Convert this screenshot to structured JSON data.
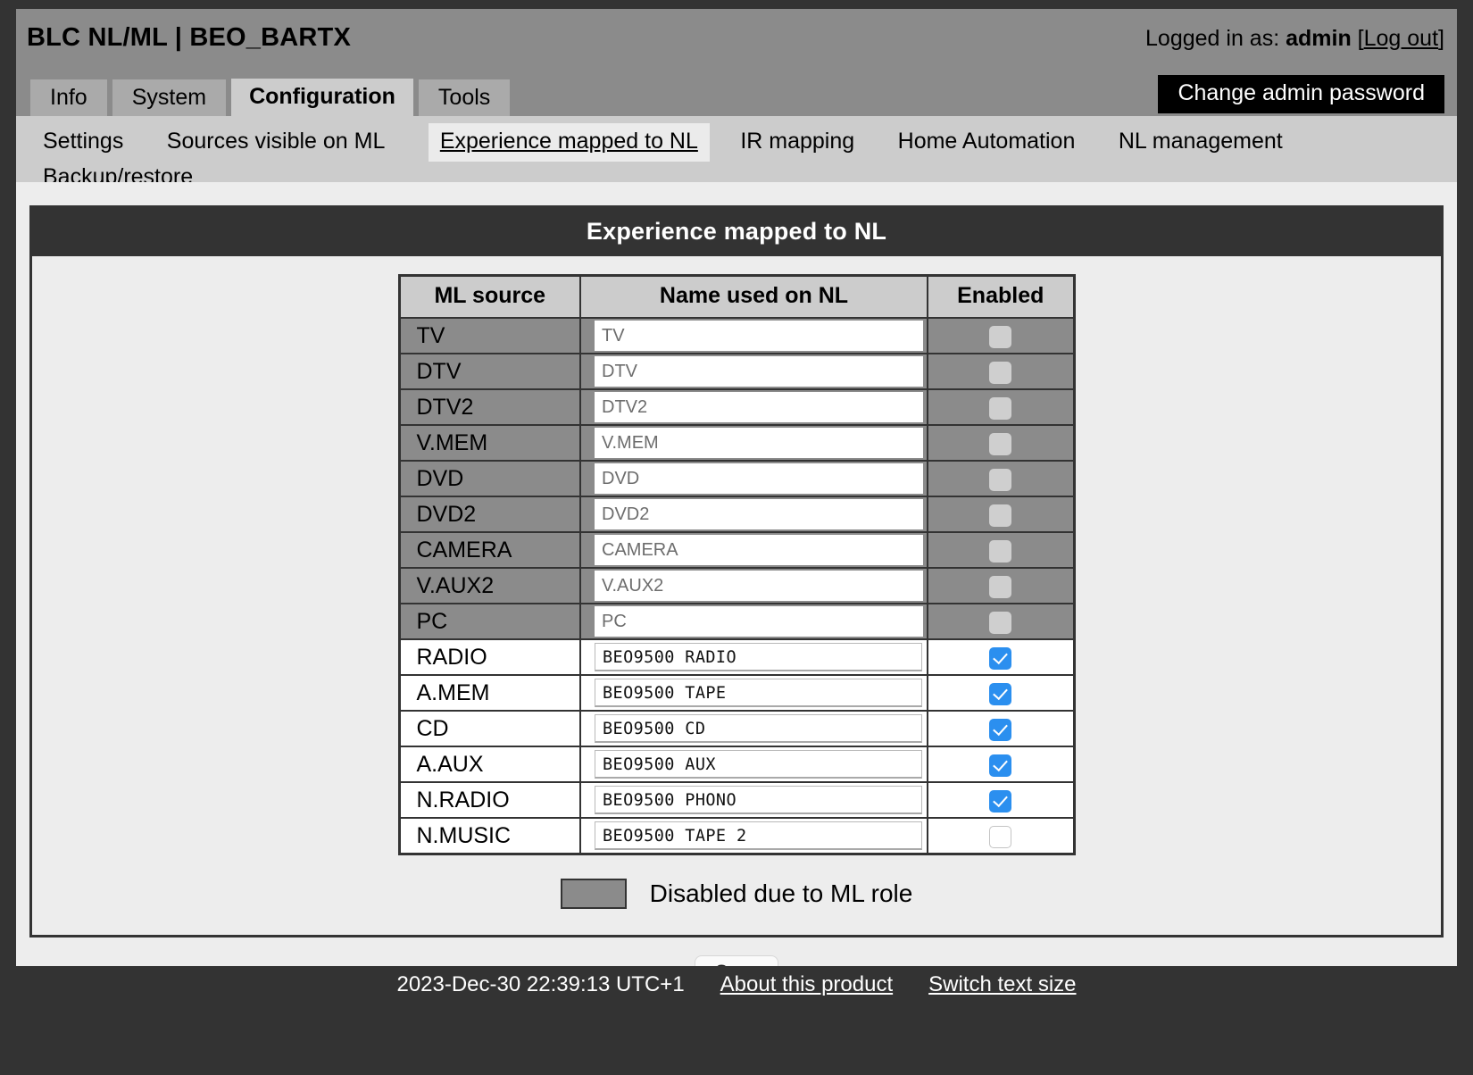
{
  "header": {
    "app_title": "BLC NL/ML | BEO_BARTX",
    "logged_in_prefix": "Logged in as:",
    "username": "admin",
    "logout_open": "[",
    "logout_label": "Log out",
    "logout_close": "]",
    "change_password_label": "Change admin password"
  },
  "tabs": [
    {
      "label": "Info",
      "active": false
    },
    {
      "label": "System",
      "active": false
    },
    {
      "label": "Configuration",
      "active": true
    },
    {
      "label": "Tools",
      "active": false
    }
  ],
  "subnav": [
    {
      "label": "Settings",
      "current": false
    },
    {
      "label": "Sources visible on ML",
      "current": false
    },
    {
      "label": "Experience mapped to NL",
      "current": true
    },
    {
      "label": "IR mapping",
      "current": false
    },
    {
      "label": "Home Automation",
      "current": false
    },
    {
      "label": "NL management",
      "current": false
    },
    {
      "label": "Backup/restore",
      "current": false
    }
  ],
  "panel": {
    "title": "Experience mapped to NL",
    "columns": [
      "ML source",
      "Name used on NL",
      "Enabled"
    ],
    "rows": [
      {
        "source": "TV",
        "name": "TV",
        "enabled": false,
        "disabled_role": true
      },
      {
        "source": "DTV",
        "name": "DTV",
        "enabled": false,
        "disabled_role": true
      },
      {
        "source": "DTV2",
        "name": "DTV2",
        "enabled": false,
        "disabled_role": true
      },
      {
        "source": "V.MEM",
        "name": "V.MEM",
        "enabled": false,
        "disabled_role": true
      },
      {
        "source": "DVD",
        "name": "DVD",
        "enabled": false,
        "disabled_role": true
      },
      {
        "source": "DVD2",
        "name": "DVD2",
        "enabled": false,
        "disabled_role": true
      },
      {
        "source": "CAMERA",
        "name": "CAMERA",
        "enabled": false,
        "disabled_role": true
      },
      {
        "source": "V.AUX2",
        "name": "V.AUX2",
        "enabled": false,
        "disabled_role": true
      },
      {
        "source": "PC",
        "name": "PC",
        "enabled": false,
        "disabled_role": true
      },
      {
        "source": "RADIO",
        "name": "BEO9500  RADIO",
        "enabled": true,
        "disabled_role": false
      },
      {
        "source": "A.MEM",
        "name": "BEO9500  TAPE",
        "enabled": true,
        "disabled_role": false
      },
      {
        "source": "CD",
        "name": "BEO9500  CD",
        "enabled": true,
        "disabled_role": false
      },
      {
        "source": "A.AUX",
        "name": "BEO9500  AUX",
        "enabled": true,
        "disabled_role": false
      },
      {
        "source": "N.RADIO",
        "name": "BEO9500  PHONO",
        "enabled": true,
        "disabled_role": false
      },
      {
        "source": "N.MUSIC",
        "name": "BEO9500  TAPE 2",
        "enabled": false,
        "disabled_role": false
      }
    ],
    "legend_label": "Disabled due to ML role",
    "save_label": "Save"
  },
  "footer": {
    "timestamp": "2023-Dec-30 22:39:13 UTC+1",
    "about_label": "About this product",
    "textsize_label": "Switch text size"
  },
  "colors": {
    "frame": "#333333",
    "titlebar": "#8b8b8b",
    "tab_inactive": "#aaaaaa",
    "tab_active": "#cccccc",
    "subnav_bg": "#cccccc",
    "body_bg": "#ededed",
    "checkbox_on": "#2b8fef",
    "disabled_row": "#8b8b8b"
  }
}
